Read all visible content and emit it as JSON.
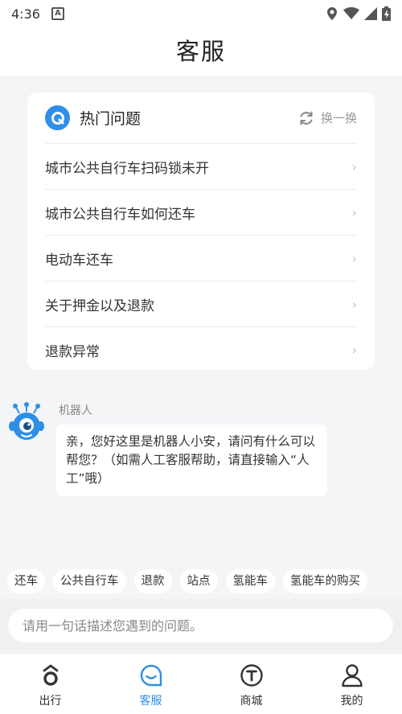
{
  "status_bar": {
    "time": "4:36"
  },
  "header": {
    "title": "客服"
  },
  "hot": {
    "title": "热门问题",
    "refresh_label": "换一换",
    "questions": [
      "城市公共自行车扫码锁未开",
      "城市公共自行车如何还车",
      "电动车还车",
      "关于押金以及退款",
      "退款异常"
    ]
  },
  "chat": {
    "sender": "机器人",
    "message": "亲，您好这里是机器人小安，请问有什么可以帮您？（如需人工客服帮助，请直接输入“人工”哦）"
  },
  "chips": [
    "还车",
    "公共自行车",
    "退款",
    "站点",
    "氢能车",
    "氢能车的购买"
  ],
  "input": {
    "placeholder": "请用一句话描述您遇到的问题。"
  },
  "tabs": [
    {
      "label": "出行",
      "icon": "ride-icon"
    },
    {
      "label": "客服",
      "icon": "chat-icon"
    },
    {
      "label": "商城",
      "icon": "mall-icon"
    },
    {
      "label": "我的",
      "icon": "person-icon"
    }
  ],
  "colors": {
    "accent": "#2e8fe8",
    "background": "#f4f5f7"
  }
}
